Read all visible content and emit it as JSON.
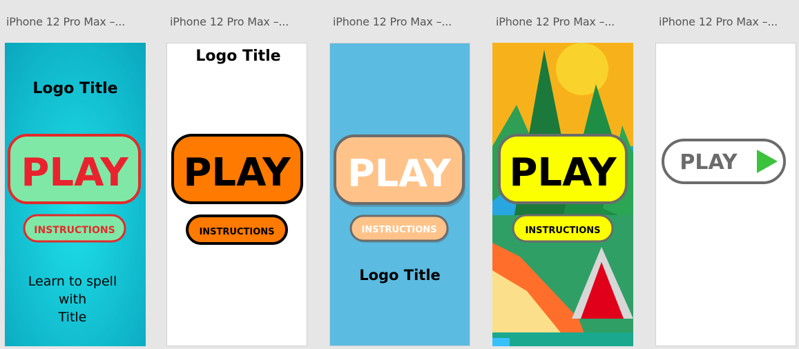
{
  "artboards": [
    {
      "label": "iPhone 12 Pro Max –...",
      "logo": "Logo Title",
      "play": "PLAY",
      "instructions": "INSTRUCTIONS",
      "tagline": [
        "Learn to spell",
        "with",
        "Title"
      ]
    },
    {
      "label": "iPhone 12 Pro Max –...",
      "logo": "Logo Title",
      "play": "PLAY",
      "instructions": "INSTRUCTIONS"
    },
    {
      "label": "iPhone 12 Pro Max –...",
      "logo": "Logo Title",
      "play": "PLAY",
      "instructions": "INSTRUCTIONS"
    },
    {
      "label": "iPhone 12 Pro Max –...",
      "play": "PLAY",
      "instructions": "INSTRUCTIONS"
    },
    {
      "label": "iPhone 12 Pro Max –...",
      "play": "PLAY",
      "play_icon": "triangle-play-icon"
    }
  ],
  "colors": {
    "canvas": "#e6e6e6",
    "teal": "#0fb7c8",
    "mint": "#7fe8a7",
    "red": "#e22b2b",
    "orange": "#ff7a00",
    "sky": "#5bbbe0",
    "peach": "#ffc38a",
    "yellow": "#fbff00",
    "gray": "#6b6b6b",
    "green": "#3cc23c"
  }
}
